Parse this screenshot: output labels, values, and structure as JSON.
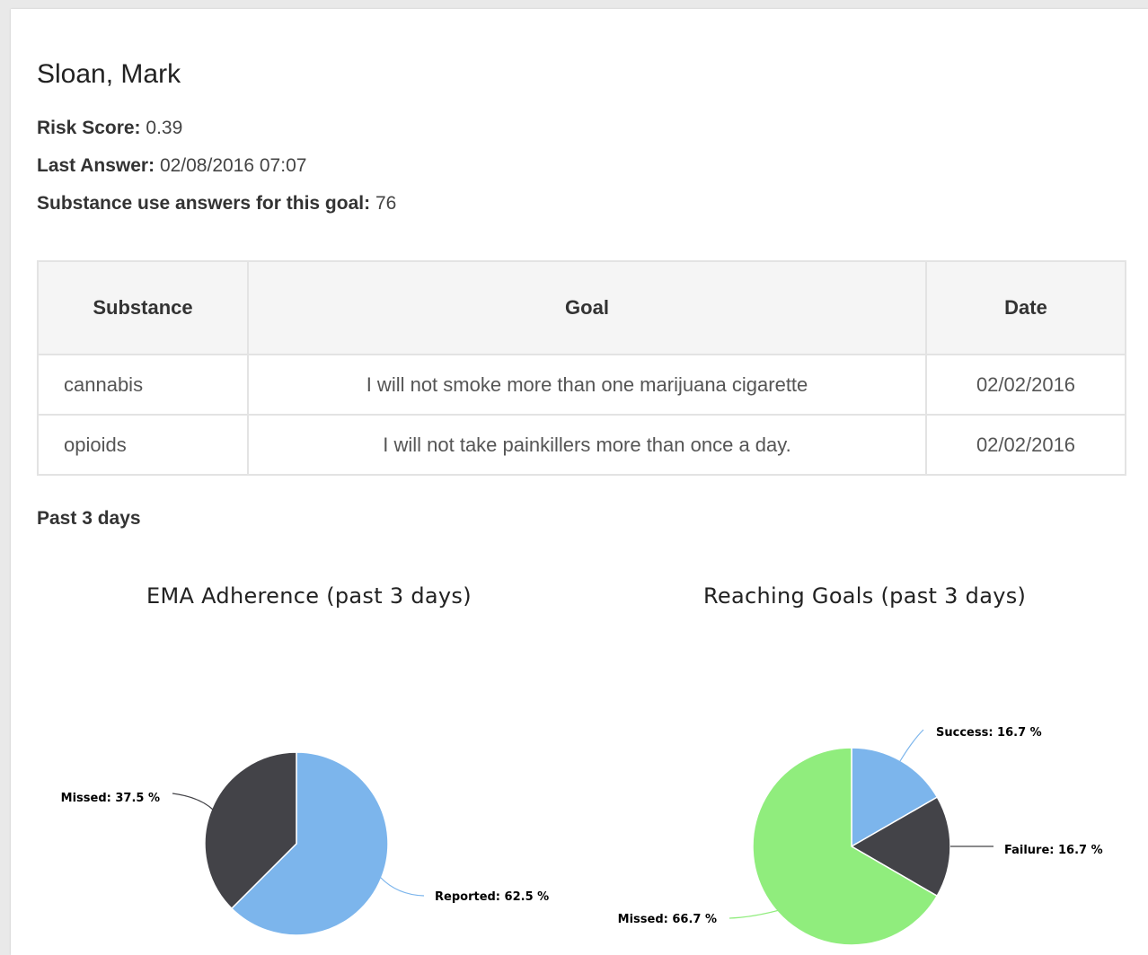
{
  "patient": {
    "name": "Sloan, Mark",
    "risk_score_label": "Risk Score:",
    "risk_score": "0.39",
    "last_answer_label": "Last Answer:",
    "last_answer": "02/08/2016 07:07",
    "answers_label": "Substance use answers for this goal:",
    "answers_count": "76"
  },
  "table": {
    "headers": [
      "Substance",
      "Goal",
      "Date"
    ],
    "rows": [
      {
        "substance": "cannabis",
        "goal": "I will not smoke more than one marijuana cigarette",
        "date": "02/02/2016"
      },
      {
        "substance": "opioids",
        "goal": "I will not take painkillers more than once a day.",
        "date": "02/02/2016"
      }
    ]
  },
  "section_title": "Past 3 days",
  "colors": {
    "blue": "#7cb5ec",
    "dark": "#434348",
    "green": "#90ed7d"
  },
  "chart_data": [
    {
      "type": "pie",
      "title": "EMA Adherence (past 3 days)",
      "slices": [
        {
          "name": "Reported",
          "value": 62.5,
          "label": "Reported: 62.5 %",
          "color": "#7cb5ec"
        },
        {
          "name": "Missed",
          "value": 37.5,
          "label": "Missed: 37.5 %",
          "color": "#434348"
        }
      ]
    },
    {
      "type": "pie",
      "title": "Reaching Goals (past 3 days)",
      "slices": [
        {
          "name": "Success",
          "value": 16.7,
          "label": "Success: 16.7 %",
          "color": "#7cb5ec"
        },
        {
          "name": "Failure",
          "value": 16.7,
          "label": "Failure: 16.7 %",
          "color": "#434348"
        },
        {
          "name": "Missed",
          "value": 66.7,
          "label": "Missed: 66.7 %",
          "color": "#90ed7d"
        }
      ]
    }
  ]
}
